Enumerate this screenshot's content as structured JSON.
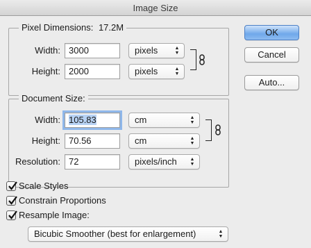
{
  "window": {
    "title": "Image Size"
  },
  "pixel_dimensions": {
    "legend_label": "Pixel Dimensions:",
    "legend_value": "17.2M",
    "width_label": "Width:",
    "width_value": "3000",
    "width_unit": "pixels",
    "height_label": "Height:",
    "height_value": "2000",
    "height_unit": "pixels"
  },
  "document_size": {
    "legend_label": "Document Size:",
    "width_label": "Width:",
    "width_value": "105.83",
    "width_unit": "cm",
    "height_label": "Height:",
    "height_value": "70.56",
    "height_unit": "cm",
    "resolution_label": "Resolution:",
    "resolution_value": "72",
    "resolution_unit": "pixels/inch"
  },
  "buttons": {
    "ok": "OK",
    "cancel": "Cancel",
    "auto": "Auto..."
  },
  "options": {
    "scale_styles": "Scale Styles",
    "constrain_proportions": "Constrain Proportions",
    "resample_image": "Resample Image:",
    "resample_method": "Bicubic Smoother (best for enlargement)"
  },
  "icons": {
    "link": "link-icon",
    "checkbox": "checkmark-icon",
    "select": "up-down-arrows-icon"
  },
  "colors": {
    "accent": "#6fa8ea",
    "selection": "#b7d2f4",
    "background": "#ececec"
  }
}
